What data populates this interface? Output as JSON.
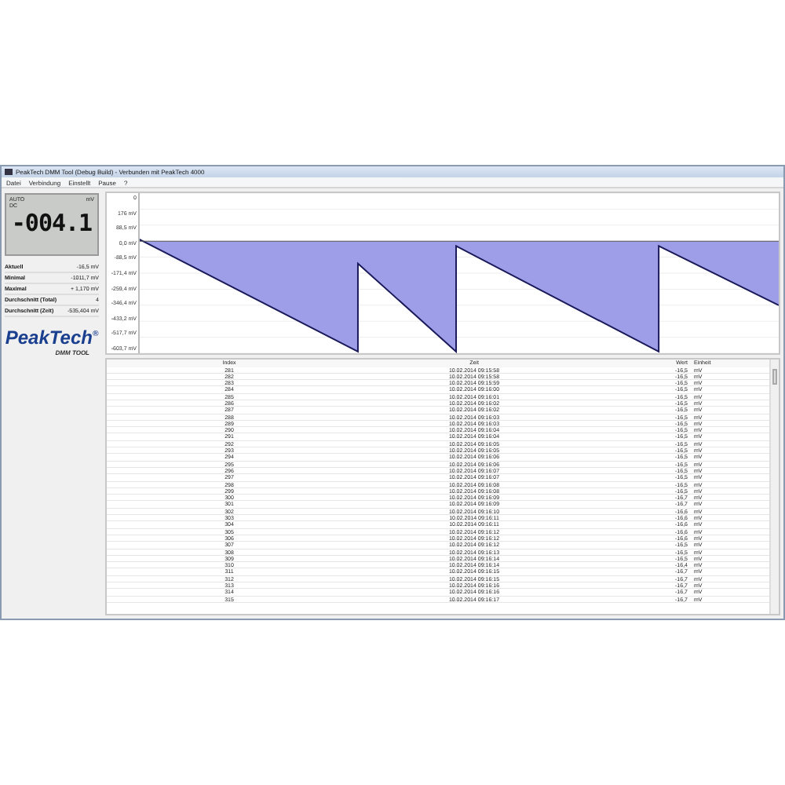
{
  "window": {
    "title": "PeakTech DMM Tool (Debug Build) - Verbunden mit PeakTech 4000"
  },
  "menu": [
    "Datei",
    "Verbindung",
    "Einstellt",
    "Pause",
    "?"
  ],
  "display": {
    "reading": "-004.1",
    "mode": "AUTO",
    "coupling": "DC",
    "unit": "mV"
  },
  "stats": [
    {
      "label": "Aktuell",
      "value": "-16,5 mV"
    },
    {
      "label": "Minimal",
      "value": "-1011,7 mV"
    },
    {
      "label": "Maximal",
      "value": "+ 1,170 mV"
    },
    {
      "label": "Durchschnitt (Total)",
      "value": "4"
    },
    {
      "label": "Durchschnitt (Zeit)",
      "value": "-535,404 mV"
    }
  ],
  "logo": {
    "brand": "PeakTech",
    "mark": "®",
    "product": "DMM TOOL"
  },
  "chart": {
    "y_axis_labels": [
      "0",
      "176 mV",
      "88,5 mV",
      "0,0 mV",
      "-88,5 mV",
      "-171,4 mV",
      "-259,4 mV",
      "-346,4 mV",
      "-433,2 mV",
      "-517,7 mV",
      "-603,7 mV"
    ]
  },
  "table": {
    "columns": [
      "Index",
      "Zeit",
      "Wert",
      "Einheit"
    ],
    "rows": [
      {
        "index": "281",
        "time": "10.02.2014 09:15:58",
        "value": "-16,5",
        "unit": "mV"
      },
      {
        "index": "282",
        "time": "10.02.2014 09:15:58",
        "value": "-16,5",
        "unit": "mV"
      },
      {
        "index": "283",
        "time": "10.02.2014 09:15:59",
        "value": "-16,5",
        "unit": "mV"
      },
      {
        "index": "284",
        "time": "10.02.2014 09:16:00",
        "value": "-16,5",
        "unit": "mV"
      },
      {
        "index": "285",
        "time": "10.02.2014 09:16:01",
        "value": "-16,5",
        "unit": "mV"
      },
      {
        "index": "286",
        "time": "10.02.2014 09:16:02",
        "value": "-16,5",
        "unit": "mV"
      },
      {
        "index": "287",
        "time": "10.02.2014 09:16:02",
        "value": "-16,5",
        "unit": "mV"
      },
      {
        "index": "288",
        "time": "10.02.2014 09:16:03",
        "value": "-16,5",
        "unit": "mV"
      },
      {
        "index": "289",
        "time": "10.02.2014 09:16:03",
        "value": "-16,5",
        "unit": "mV"
      },
      {
        "index": "290",
        "time": "10.02.2014 09:16:04",
        "value": "-16,5",
        "unit": "mV"
      },
      {
        "index": "291",
        "time": "10.02.2014 09:16:04",
        "value": "-16,5",
        "unit": "mV"
      },
      {
        "index": "292",
        "time": "10.02.2014 09:16:05",
        "value": "-16,5",
        "unit": "mV"
      },
      {
        "index": "293",
        "time": "10.02.2014 09:16:05",
        "value": "-16,5",
        "unit": "mV"
      },
      {
        "index": "294",
        "time": "10.02.2014 09:16:06",
        "value": "-16,5",
        "unit": "mV"
      },
      {
        "index": "295",
        "time": "10.02.2014 09:16:06",
        "value": "-16,5",
        "unit": "mV"
      },
      {
        "index": "296",
        "time": "10.02.2014 09:16:07",
        "value": "-16,5",
        "unit": "mV"
      },
      {
        "index": "297",
        "time": "10.02.2014 09:16:07",
        "value": "-16,5",
        "unit": "mV"
      },
      {
        "index": "298",
        "time": "10.02.2014 09:16:08",
        "value": "-16,5",
        "unit": "mV"
      },
      {
        "index": "299",
        "time": "10.02.2014 09:16:08",
        "value": "-16,5",
        "unit": "mV"
      },
      {
        "index": "300",
        "time": "10.02.2014 09:16:09",
        "value": "-16,7",
        "unit": "mV"
      },
      {
        "index": "301",
        "time": "10.02.2014 09:16:09",
        "value": "-16,7",
        "unit": "mV"
      },
      {
        "index": "302",
        "time": "10.02.2014 09:16:10",
        "value": "-16,6",
        "unit": "mV"
      },
      {
        "index": "303",
        "time": "10.02.2014 09:16:11",
        "value": "-16,6",
        "unit": "mV"
      },
      {
        "index": "304",
        "time": "10.02.2014 09:16:11",
        "value": "-16,6",
        "unit": "mV"
      },
      {
        "index": "305",
        "time": "10.02.2014 09:16:12",
        "value": "-16,6",
        "unit": "mV"
      },
      {
        "index": "306",
        "time": "10.02.2014 09:16:12",
        "value": "-16,6",
        "unit": "mV"
      },
      {
        "index": "307",
        "time": "10.02.2014 09:16:12",
        "value": "-16,5",
        "unit": "mV"
      },
      {
        "index": "308",
        "time": "10.02.2014 09:16:13",
        "value": "-16,5",
        "unit": "mV"
      },
      {
        "index": "309",
        "time": "10.02.2014 09:16:14",
        "value": "-16,5",
        "unit": "mV"
      },
      {
        "index": "310",
        "time": "10.02.2014 09:16:14",
        "value": "-16,4",
        "unit": "mV"
      },
      {
        "index": "311",
        "time": "10.02.2014 09:16:15",
        "value": "-16,7",
        "unit": "mV"
      },
      {
        "index": "312",
        "time": "10.02.2014 09:16:15",
        "value": "-16,7",
        "unit": "mV"
      },
      {
        "index": "313",
        "time": "10.02.2014 09:16:16",
        "value": "-16,7",
        "unit": "mV"
      },
      {
        "index": "314",
        "time": "10.02.2014 09:16:16",
        "value": "-16,7",
        "unit": "mV"
      },
      {
        "index": "315",
        "time": "10.02.2014 09:16:17",
        "value": "-16,7",
        "unit": "mV"
      }
    ]
  }
}
